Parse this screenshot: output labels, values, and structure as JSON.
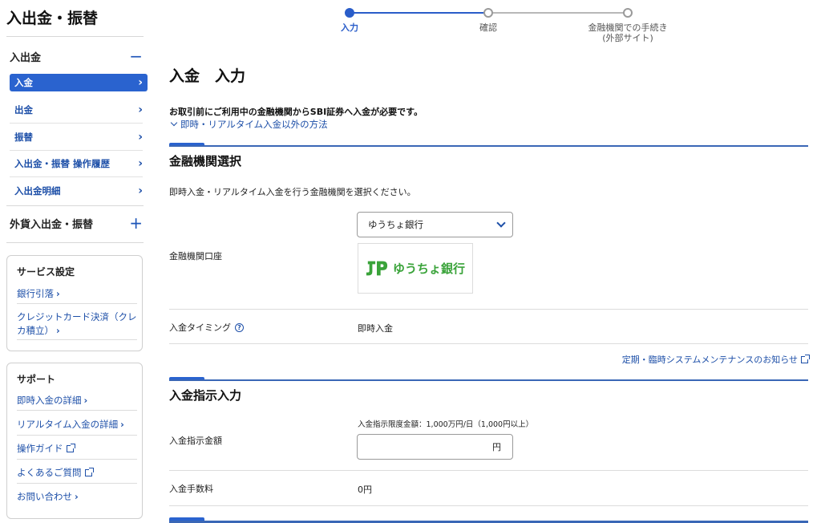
{
  "sidebar": {
    "title": "入出金・振替",
    "section1": {
      "label": "入出金",
      "toggle": "−"
    },
    "items": [
      {
        "label": "入金"
      },
      {
        "label": "出金"
      },
      {
        "label": "振替"
      },
      {
        "label": "入出金・振替 操作履歴"
      },
      {
        "label": "入出金明細"
      }
    ],
    "section2": {
      "label": "外貨入出金・振替",
      "toggle": "+"
    },
    "service": {
      "title": "サービス設定",
      "links": [
        "銀行引落",
        "クレジットカード決済（クレカ積立）"
      ]
    },
    "support": {
      "title": "サポート",
      "links": [
        "即時入金の詳細",
        "リアルタイム入金の詳細",
        "操作ガイド",
        "よくあるご質問",
        "お問い合わせ"
      ]
    }
  },
  "stepper": {
    "steps": [
      {
        "label": "入力",
        "state": "current"
      },
      {
        "label": "確認",
        "state": "pending"
      },
      {
        "label": "金融機関での手続き",
        "sub": "(外部サイト)",
        "state": "pending"
      }
    ]
  },
  "main": {
    "title": "入金　入力",
    "notice": "お取引前にご利用中の金融機関からSBI証券へ入金が必要です。",
    "toggle_link": "即時・リアルタイム入金以外の方法",
    "bank_section": {
      "title": "金融機関選択",
      "description": "即時入金・リアルタイム入金を行う金融機関を選択ください。",
      "account_label": "金融機関口座",
      "selected_bank": "ゆうちょ銀行",
      "logo_text": "ゆうちょ銀行",
      "timing_label": "入金タイミング",
      "timing_value": "即時入金",
      "maintenance_link": "定期・臨時システムメンテナンスのお知らせ"
    },
    "instruction_section": {
      "title": "入金指示入力",
      "amount_label": "入金指示金額",
      "limit_note": "入金指示限度金額：1,000万円/日（1,000円以上）",
      "amount_value": "",
      "amount_unit": "円",
      "fee_label": "入金手数料",
      "fee_value": "0円"
    }
  },
  "colors": {
    "accent": "#2a63cf",
    "link": "#1d4fa8",
    "logo_green": "#3aa33a"
  }
}
